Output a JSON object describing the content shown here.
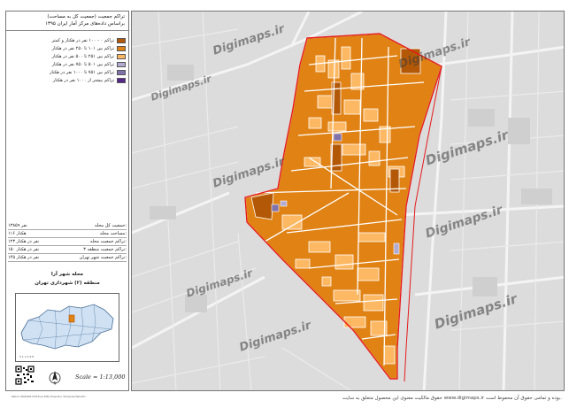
{
  "title": {
    "line1": "تراکم جمعیت (جمعیت کل به مساحت)",
    "line2": "براساس داده‌های مرکز آمار ایران ۱۳۹۵"
  },
  "legend": [
    {
      "label": "تراکم ۰ - ۱۰۰ نفر در هکتار و کمتر",
      "color": "#b35806"
    },
    {
      "label": "تراکم بین ۱۰۱ تا ۲۵۰ نفر در هکتار",
      "color": "#e08214"
    },
    {
      "label": "تراکم بین ۲۵۱ تا ۵۰۰ نفر در هکتار",
      "color": "#fdb863"
    },
    {
      "label": "تراکم بین ۵۰۱ تا ۷۵۰ نفر در هکتار",
      "color": "#b2abd2"
    },
    {
      "label": "تراکم بین ۷۵۱ تا ۱۰۰۰ نفر در هکتار",
      "color": "#8073ac"
    },
    {
      "label": "تراکم بیشتر از ۱۰۰۰ نفر در هکتار",
      "color": "#542788"
    }
  ],
  "stats": [
    {
      "label": "جمعیت کل محله:",
      "value": "۱۳۸۵۹ نفر"
    },
    {
      "label": "مساحت محله:",
      "value": "۱۱۶ هکتار"
    },
    {
      "label": "تراکم جمعیت محله:",
      "value": "۱۲۳ نفر در هکتار"
    },
    {
      "label": "تراکم جمعیت منطقه ۳:",
      "value": "۱۵۰ نفر در هکتار"
    },
    {
      "label": "تراکم جمعیت شهر تهران:",
      "value": "۱۴۵ نفر در هکتار"
    }
  ],
  "place": {
    "neighborhood": "محله شهر آرا",
    "district": "منطقه (۲) شهرداری تهران"
  },
  "scale": "Scale = 1:13,000",
  "panel_footer": "Datum: WGS1984 UTM Zone 39N | Projection: Transverse Mercator",
  "watermark": "Digimaps.ir",
  "copyright": "حقوق مالکیت معنوی این محصول متعلق به سایت www.digimaps.ir بوده و تمامی حقوق آن محفوظ است.",
  "colors": {
    "dark": "#b35806",
    "mid": "#e08214",
    "light": "#fdb863",
    "lilac": "#b2abd2",
    "purple": "#8073ac",
    "boundary": "#e41a1c",
    "basemap": "#dcdcdc",
    "road": "#ffffff"
  },
  "icons": [
    "north-arrow-icon",
    "qr-code-icon"
  ]
}
